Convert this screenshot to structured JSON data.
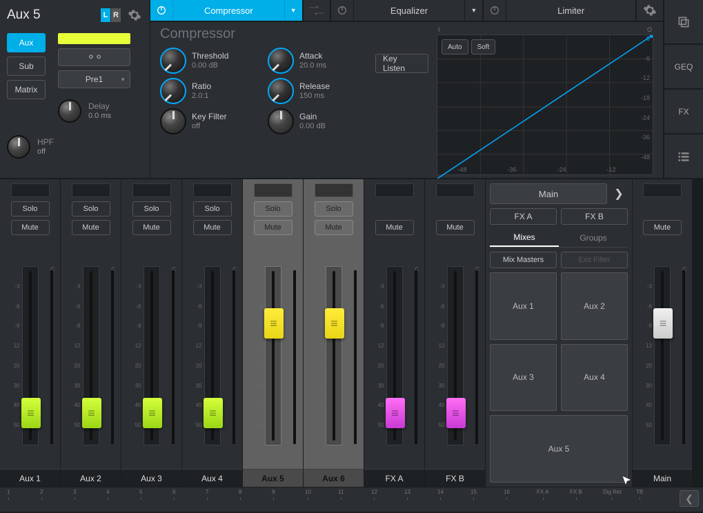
{
  "channel": {
    "title": "Aux 5",
    "lr_l": "L",
    "lr_r": "R"
  },
  "left": {
    "aux_btn": "Aux",
    "sub_btn": "Sub",
    "matrix_btn": "Matrix",
    "pre_select": "Pre1",
    "delay": {
      "label": "Delay",
      "value": "0.0 ms"
    },
    "hpf": {
      "label": "HPF",
      "value": "off"
    }
  },
  "fx_chain": {
    "slots": [
      {
        "name": "Compressor",
        "on": true
      },
      {
        "name": "Equalizer",
        "on": false
      },
      {
        "name": "Limiter",
        "on": false
      }
    ]
  },
  "compressor": {
    "title": "Compressor",
    "threshold": {
      "label": "Threshold",
      "value": "0.00 dB"
    },
    "attack": {
      "label": "Attack",
      "value": "20.0 ms"
    },
    "ratio": {
      "label": "Ratio",
      "value": "2.0:1"
    },
    "release": {
      "label": "Release",
      "value": "150 ms"
    },
    "keyfilter": {
      "label": "Key Filter",
      "value": "off"
    },
    "gain": {
      "label": "Gain",
      "value": "0.00 dB"
    },
    "key_listen": "Key Listen",
    "graph": {
      "in_label": "I",
      "out_label": "O",
      "auto": "Auto",
      "soft": "Soft",
      "y_ticks": [
        "0",
        "-6",
        "-12",
        "-18",
        "-24",
        "-36",
        "-48"
      ],
      "x_ticks": [
        "-48",
        "-36",
        "-24",
        "-12"
      ]
    }
  },
  "rail": {
    "geq": "GEQ",
    "fx": "FX"
  },
  "strips": [
    {
      "name": "Aux 1",
      "solo": "Solo",
      "mute": "Mute",
      "sel": false,
      "cap": "green",
      "pos": 190
    },
    {
      "name": "Aux 2",
      "solo": "Solo",
      "mute": "Mute",
      "sel": false,
      "cap": "green",
      "pos": 190
    },
    {
      "name": "Aux 3",
      "solo": "Solo",
      "mute": "Mute",
      "sel": false,
      "cap": "green",
      "pos": 190
    },
    {
      "name": "Aux 4",
      "solo": "Solo",
      "mute": "Mute",
      "sel": false,
      "cap": "green",
      "pos": 190
    },
    {
      "name": "Aux 5",
      "solo": "Solo",
      "mute": "Mute",
      "sel": true,
      "cap": "yellow",
      "pos": 60
    },
    {
      "name": "Aux 6",
      "solo": "Solo",
      "mute": "Mute",
      "sel": true,
      "cap": "yellow",
      "pos": 60
    },
    {
      "name": "FX A",
      "solo": null,
      "mute": "Mute",
      "sel": false,
      "cap": "pink",
      "pos": 190
    },
    {
      "name": "FX B",
      "solo": null,
      "mute": "Mute",
      "sel": false,
      "cap": "pink",
      "pos": 190
    }
  ],
  "main_strip": {
    "name": "Main",
    "mute": "Mute",
    "cap": "white",
    "pos": 60
  },
  "mix_panel": {
    "main": "Main",
    "fxa": "FX A",
    "fxb": "FX B",
    "tab_mixes": "Mixes",
    "tab_groups": "Groups",
    "mix_masters": "Mix Masters",
    "exit_filter": "Exit Filter",
    "aux": [
      "Aux 1",
      "Aux 2",
      "Aux 3",
      "Aux 4",
      "Aux 5"
    ]
  },
  "fader_ticks": [
    "",
    "-3",
    "-6",
    "-9",
    "12",
    "20",
    "30",
    "40",
    "50",
    ""
  ],
  "timeline": {
    "labels": [
      "1",
      "2",
      "3",
      "4",
      "5",
      "6",
      "7",
      "8",
      "9",
      "10",
      "11",
      "12",
      "13",
      "14",
      "15",
      "16",
      "FX A",
      "FX B",
      "Dig Ret",
      "TB"
    ]
  }
}
